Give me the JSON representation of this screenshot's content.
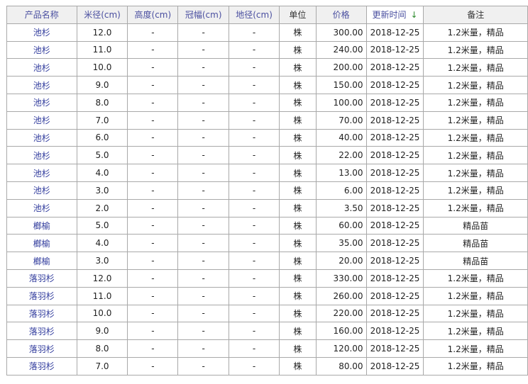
{
  "columns": {
    "name": "产品名称",
    "diameter": "米径(cm)",
    "height": "高度(cm)",
    "crown": "冠幅(cm)",
    "ground": "地径(cm)",
    "unit": "单位",
    "price": "价格",
    "updated": "更新时间",
    "note": "备注"
  },
  "sort_icon": "down-arrow-icon",
  "sort_arrow_glyph": "↓",
  "rows": [
    {
      "name": "池杉",
      "diameter": "12.0",
      "height": "-",
      "crown": "-",
      "ground": "-",
      "unit": "株",
      "price": "300.00",
      "updated": "2018-12-25",
      "note": "1.2米量，精品"
    },
    {
      "name": "池杉",
      "diameter": "11.0",
      "height": "-",
      "crown": "-",
      "ground": "-",
      "unit": "株",
      "price": "240.00",
      "updated": "2018-12-25",
      "note": "1.2米量，精品"
    },
    {
      "name": "池杉",
      "diameter": "10.0",
      "height": "-",
      "crown": "-",
      "ground": "-",
      "unit": "株",
      "price": "200.00",
      "updated": "2018-12-25",
      "note": "1.2米量，精品"
    },
    {
      "name": "池杉",
      "diameter": "9.0",
      "height": "-",
      "crown": "-",
      "ground": "-",
      "unit": "株",
      "price": "150.00",
      "updated": "2018-12-25",
      "note": "1.2米量，精品"
    },
    {
      "name": "池杉",
      "diameter": "8.0",
      "height": "-",
      "crown": "-",
      "ground": "-",
      "unit": "株",
      "price": "100.00",
      "updated": "2018-12-25",
      "note": "1.2米量，精品"
    },
    {
      "name": "池杉",
      "diameter": "7.0",
      "height": "-",
      "crown": "-",
      "ground": "-",
      "unit": "株",
      "price": "70.00",
      "updated": "2018-12-25",
      "note": "1.2米量，精品"
    },
    {
      "name": "池杉",
      "diameter": "6.0",
      "height": "-",
      "crown": "-",
      "ground": "-",
      "unit": "株",
      "price": "40.00",
      "updated": "2018-12-25",
      "note": "1.2米量，精品"
    },
    {
      "name": "池杉",
      "diameter": "5.0",
      "height": "-",
      "crown": "-",
      "ground": "-",
      "unit": "株",
      "price": "22.00",
      "updated": "2018-12-25",
      "note": "1.2米量，精品"
    },
    {
      "name": "池杉",
      "diameter": "4.0",
      "height": "-",
      "crown": "-",
      "ground": "-",
      "unit": "株",
      "price": "13.00",
      "updated": "2018-12-25",
      "note": "1.2米量，精品"
    },
    {
      "name": "池杉",
      "diameter": "3.0",
      "height": "-",
      "crown": "-",
      "ground": "-",
      "unit": "株",
      "price": "6.00",
      "updated": "2018-12-25",
      "note": "1.2米量，精品"
    },
    {
      "name": "池杉",
      "diameter": "2.0",
      "height": "-",
      "crown": "-",
      "ground": "-",
      "unit": "株",
      "price": "3.50",
      "updated": "2018-12-25",
      "note": "1.2米量，精品"
    },
    {
      "name": "榔榆",
      "diameter": "5.0",
      "height": "-",
      "crown": "-",
      "ground": "-",
      "unit": "株",
      "price": "60.00",
      "updated": "2018-12-25",
      "note": "精品苗"
    },
    {
      "name": "榔榆",
      "diameter": "4.0",
      "height": "-",
      "crown": "-",
      "ground": "-",
      "unit": "株",
      "price": "35.00",
      "updated": "2018-12-25",
      "note": "精品苗"
    },
    {
      "name": "榔榆",
      "diameter": "3.0",
      "height": "-",
      "crown": "-",
      "ground": "-",
      "unit": "株",
      "price": "20.00",
      "updated": "2018-12-25",
      "note": "精品苗"
    },
    {
      "name": "落羽杉",
      "diameter": "12.0",
      "height": "-",
      "crown": "-",
      "ground": "-",
      "unit": "株",
      "price": "330.00",
      "updated": "2018-12-25",
      "note": "1.2米量，精品"
    },
    {
      "name": "落羽杉",
      "diameter": "11.0",
      "height": "-",
      "crown": "-",
      "ground": "-",
      "unit": "株",
      "price": "260.00",
      "updated": "2018-12-25",
      "note": "1.2米量，精品"
    },
    {
      "name": "落羽杉",
      "diameter": "10.0",
      "height": "-",
      "crown": "-",
      "ground": "-",
      "unit": "株",
      "price": "220.00",
      "updated": "2018-12-25",
      "note": "1.2米量，精品"
    },
    {
      "name": "落羽杉",
      "diameter": "9.0",
      "height": "-",
      "crown": "-",
      "ground": "-",
      "unit": "株",
      "price": "160.00",
      "updated": "2018-12-25",
      "note": "1.2米量，精品"
    },
    {
      "name": "落羽杉",
      "diameter": "8.0",
      "height": "-",
      "crown": "-",
      "ground": "-",
      "unit": "株",
      "price": "120.00",
      "updated": "2018-12-25",
      "note": "1.2米量，精品"
    },
    {
      "name": "落羽杉",
      "diameter": "7.0",
      "height": "-",
      "crown": "-",
      "ground": "-",
      "unit": "株",
      "price": "80.00",
      "updated": "2018-12-25",
      "note": "1.2米量，精品"
    }
  ]
}
